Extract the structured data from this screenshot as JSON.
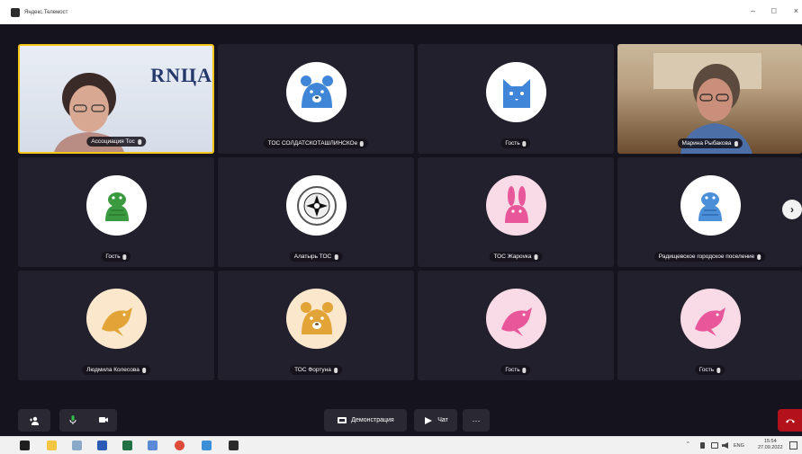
{
  "window": {
    "title": "Яндекс.Телемост",
    "min_label": "–",
    "max_label": "◻",
    "close_label": "×"
  },
  "participants": [
    {
      "name": "Ассоциация Тос",
      "kind": "video",
      "active": true
    },
    {
      "name": "ТОС СОЛДАТСКОТАШЛИНСКОе",
      "kind": "avatar",
      "animal": "bear",
      "bg": "#ffffff",
      "color": "#3f86d9"
    },
    {
      "name": "Гость",
      "kind": "avatar",
      "animal": "cat",
      "bg": "#ffffff",
      "color": "#3f86d9"
    },
    {
      "name": "Марина Рыбакова",
      "kind": "video"
    },
    {
      "name": "Гость",
      "kind": "avatar",
      "animal": "turtle",
      "bg": "#ffffff",
      "color": "#3b9a3f"
    },
    {
      "name": "Алатырь ТОС",
      "kind": "avatar",
      "animal": "emblem",
      "bg": "#ffffff",
      "color": "#111111"
    },
    {
      "name": "ТОС Жарovка",
      "kind": "avatar",
      "animal": "rabbit",
      "bg": "#f9dbe7",
      "color": "#e8579a"
    },
    {
      "name": "Радищевское городское поселение",
      "kind": "avatar",
      "animal": "turtle",
      "bg": "#ffffff",
      "color": "#4b8fd8"
    },
    {
      "name": "Людмила Колесова",
      "kind": "avatar",
      "animal": "dolphin",
      "bg": "#fbe7cc",
      "color": "#e3a437"
    },
    {
      "name": "ТОС Фортуна",
      "kind": "avatar",
      "animal": "bear",
      "bg": "#fbe7cc",
      "color": "#e3a437"
    },
    {
      "name": "Гость",
      "kind": "avatar",
      "animal": "dolphin",
      "bg": "#f9dbe7",
      "color": "#e8579a"
    },
    {
      "name": "Гость",
      "kind": "avatar",
      "animal": "dolphin",
      "bg": "#f9dbe7",
      "color": "#e8579a"
    }
  ],
  "banner_text": "RNЦА",
  "next_page_icon": "chevron-right",
  "controls": {
    "add_participant_icon": "add-user",
    "mic_icon": "microphone",
    "camera_icon": "camera",
    "screen_share_label": "Демонстрация",
    "chat_label": "Чат",
    "more_label": "···",
    "end_call_icon": "phone-hangup",
    "end_call_color": "#b3121b"
  },
  "taskbar": {
    "lang": "ENG",
    "time": "15:54",
    "date": "27.09.2022",
    "tray_arrow": "^"
  }
}
